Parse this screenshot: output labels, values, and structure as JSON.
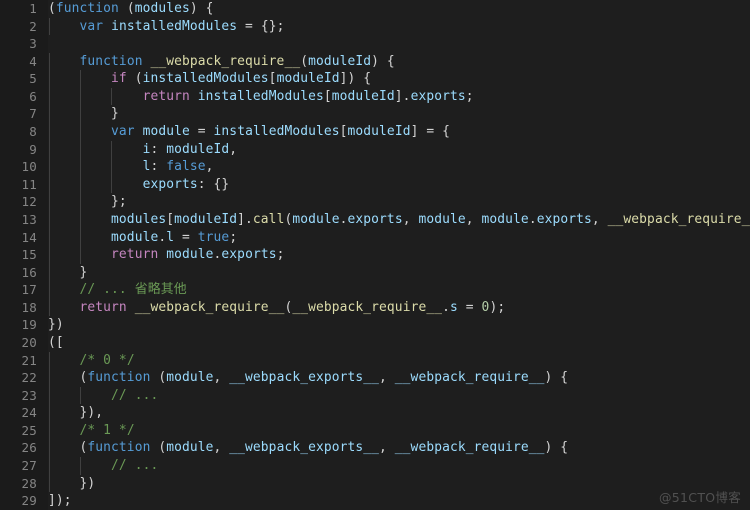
{
  "editor": {
    "theme": "vscode-dark",
    "background_color": "#1e1e1e",
    "gutter_background_color": "#1b1b1b",
    "line_number_color": "#858585",
    "indent_guide_color": "#404040",
    "default_text_color": "#d4d4d4",
    "language": "javascript",
    "total_lines": 29,
    "colors": {
      "keyword": "#569cd6",
      "control": "#c586c0",
      "function": "#dcdcaa",
      "variable": "#9cdcfe",
      "number": "#b5cea8",
      "comment": "#6a9955",
      "punctuation": "#d4d4d4"
    },
    "line_numbers": [
      "1",
      "2",
      "3",
      "4",
      "5",
      "6",
      "7",
      "8",
      "9",
      "10",
      "11",
      "12",
      "13",
      "14",
      "15",
      "16",
      "17",
      "18",
      "19",
      "20",
      "21",
      "22",
      "23",
      "24",
      "25",
      "26",
      "27",
      "28",
      "29"
    ],
    "lines": [
      {
        "n": "1",
        "indent": 0,
        "text": "(function (modules) {",
        "tokens": [
          {
            "t": "(",
            "c": "pun"
          },
          {
            "t": "function",
            "c": "kw"
          },
          {
            "t": " (",
            "c": "pun"
          },
          {
            "t": "modules",
            "c": "var"
          },
          {
            "t": ") {",
            "c": "pun"
          }
        ]
      },
      {
        "n": "2",
        "indent": 1,
        "text": "    var installedModules = {};",
        "tokens": [
          {
            "t": "    ",
            "c": "pun"
          },
          {
            "t": "var",
            "c": "kw"
          },
          {
            "t": " ",
            "c": "pun"
          },
          {
            "t": "installedModules",
            "c": "var"
          },
          {
            "t": " = {};",
            "c": "pun"
          }
        ]
      },
      {
        "n": "3",
        "indent": 0,
        "text": "",
        "tokens": []
      },
      {
        "n": "4",
        "indent": 1,
        "text": "    function __webpack_require__(moduleId) {",
        "tokens": [
          {
            "t": "    ",
            "c": "pun"
          },
          {
            "t": "function",
            "c": "kw"
          },
          {
            "t": " ",
            "c": "pun"
          },
          {
            "t": "__webpack_require__",
            "c": "fn"
          },
          {
            "t": "(",
            "c": "pun"
          },
          {
            "t": "moduleId",
            "c": "var"
          },
          {
            "t": ") {",
            "c": "pun"
          }
        ]
      },
      {
        "n": "5",
        "indent": 2,
        "text": "        if (installedModules[moduleId]) {",
        "tokens": [
          {
            "t": "        ",
            "c": "pun"
          },
          {
            "t": "if",
            "c": "ctl"
          },
          {
            "t": " (",
            "c": "pun"
          },
          {
            "t": "installedModules",
            "c": "var"
          },
          {
            "t": "[",
            "c": "pun"
          },
          {
            "t": "moduleId",
            "c": "var"
          },
          {
            "t": "]) {",
            "c": "pun"
          }
        ]
      },
      {
        "n": "6",
        "indent": 3,
        "text": "            return installedModules[moduleId].exports;",
        "tokens": [
          {
            "t": "            ",
            "c": "pun"
          },
          {
            "t": "return",
            "c": "ctl"
          },
          {
            "t": " ",
            "c": "pun"
          },
          {
            "t": "installedModules",
            "c": "var"
          },
          {
            "t": "[",
            "c": "pun"
          },
          {
            "t": "moduleId",
            "c": "var"
          },
          {
            "t": "].",
            "c": "pun"
          },
          {
            "t": "exports",
            "c": "var"
          },
          {
            "t": ";",
            "c": "pun"
          }
        ]
      },
      {
        "n": "7",
        "indent": 2,
        "text": "        }",
        "tokens": [
          {
            "t": "        }",
            "c": "pun"
          }
        ]
      },
      {
        "n": "8",
        "indent": 2,
        "text": "        var module = installedModules[moduleId] = {",
        "tokens": [
          {
            "t": "        ",
            "c": "pun"
          },
          {
            "t": "var",
            "c": "kw"
          },
          {
            "t": " ",
            "c": "pun"
          },
          {
            "t": "module",
            "c": "var"
          },
          {
            "t": " = ",
            "c": "pun"
          },
          {
            "t": "installedModules",
            "c": "var"
          },
          {
            "t": "[",
            "c": "pun"
          },
          {
            "t": "moduleId",
            "c": "var"
          },
          {
            "t": "] = {",
            "c": "pun"
          }
        ]
      },
      {
        "n": "9",
        "indent": 3,
        "text": "            i: moduleId,",
        "tokens": [
          {
            "t": "            ",
            "c": "pun"
          },
          {
            "t": "i",
            "c": "prop"
          },
          {
            "t": ": ",
            "c": "pun"
          },
          {
            "t": "moduleId",
            "c": "var"
          },
          {
            "t": ",",
            "c": "pun"
          }
        ]
      },
      {
        "n": "10",
        "indent": 3,
        "text": "            l: false,",
        "tokens": [
          {
            "t": "            ",
            "c": "pun"
          },
          {
            "t": "l",
            "c": "prop"
          },
          {
            "t": ": ",
            "c": "pun"
          },
          {
            "t": "false",
            "c": "kw"
          },
          {
            "t": ",",
            "c": "pun"
          }
        ]
      },
      {
        "n": "11",
        "indent": 3,
        "text": "            exports: {}",
        "tokens": [
          {
            "t": "            ",
            "c": "pun"
          },
          {
            "t": "exports",
            "c": "prop"
          },
          {
            "t": ": {}",
            "c": "pun"
          }
        ]
      },
      {
        "n": "12",
        "indent": 2,
        "text": "        };",
        "tokens": [
          {
            "t": "        };",
            "c": "pun"
          }
        ]
      },
      {
        "n": "13",
        "indent": 2,
        "text": "        modules[moduleId].call(module.exports, module, module.exports, __webpack_require__);",
        "tokens": [
          {
            "t": "        ",
            "c": "pun"
          },
          {
            "t": "modules",
            "c": "var"
          },
          {
            "t": "[",
            "c": "pun"
          },
          {
            "t": "moduleId",
            "c": "var"
          },
          {
            "t": "].",
            "c": "pun"
          },
          {
            "t": "call",
            "c": "fn"
          },
          {
            "t": "(",
            "c": "pun"
          },
          {
            "t": "module",
            "c": "var"
          },
          {
            "t": ".",
            "c": "pun"
          },
          {
            "t": "exports",
            "c": "var"
          },
          {
            "t": ", ",
            "c": "pun"
          },
          {
            "t": "module",
            "c": "var"
          },
          {
            "t": ", ",
            "c": "pun"
          },
          {
            "t": "module",
            "c": "var"
          },
          {
            "t": ".",
            "c": "pun"
          },
          {
            "t": "exports",
            "c": "var"
          },
          {
            "t": ", ",
            "c": "pun"
          },
          {
            "t": "__webpack_require__",
            "c": "fn"
          },
          {
            "t": ");",
            "c": "pun"
          }
        ]
      },
      {
        "n": "14",
        "indent": 2,
        "text": "        module.l = true;",
        "tokens": [
          {
            "t": "        ",
            "c": "pun"
          },
          {
            "t": "module",
            "c": "var"
          },
          {
            "t": ".",
            "c": "pun"
          },
          {
            "t": "l",
            "c": "var"
          },
          {
            "t": " = ",
            "c": "pun"
          },
          {
            "t": "true",
            "c": "kw"
          },
          {
            "t": ";",
            "c": "pun"
          }
        ]
      },
      {
        "n": "15",
        "indent": 2,
        "text": "        return module.exports;",
        "tokens": [
          {
            "t": "        ",
            "c": "pun"
          },
          {
            "t": "return",
            "c": "ctl"
          },
          {
            "t": " ",
            "c": "pun"
          },
          {
            "t": "module",
            "c": "var"
          },
          {
            "t": ".",
            "c": "pun"
          },
          {
            "t": "exports",
            "c": "var"
          },
          {
            "t": ";",
            "c": "pun"
          }
        ]
      },
      {
        "n": "16",
        "indent": 1,
        "text": "    }",
        "tokens": [
          {
            "t": "    }",
            "c": "pun"
          }
        ]
      },
      {
        "n": "17",
        "indent": 1,
        "text": "    // ... 省略其他",
        "tokens": [
          {
            "t": "    ",
            "c": "pun"
          },
          {
            "t": "// ... 省略其他",
            "c": "com"
          }
        ]
      },
      {
        "n": "18",
        "indent": 1,
        "text": "    return __webpack_require__(__webpack_require__.s = 0);",
        "tokens": [
          {
            "t": "    ",
            "c": "pun"
          },
          {
            "t": "return",
            "c": "ctl"
          },
          {
            "t": " ",
            "c": "pun"
          },
          {
            "t": "__webpack_require__",
            "c": "fn"
          },
          {
            "t": "(",
            "c": "pun"
          },
          {
            "t": "__webpack_require__",
            "c": "fn"
          },
          {
            "t": ".",
            "c": "pun"
          },
          {
            "t": "s",
            "c": "var"
          },
          {
            "t": " = ",
            "c": "pun"
          },
          {
            "t": "0",
            "c": "num"
          },
          {
            "t": ");",
            "c": "pun"
          }
        ]
      },
      {
        "n": "19",
        "indent": 0,
        "text": "})",
        "tokens": [
          {
            "t": "})",
            "c": "pun"
          }
        ]
      },
      {
        "n": "20",
        "indent": 0,
        "text": "([",
        "tokens": [
          {
            "t": "([",
            "c": "pun"
          }
        ]
      },
      {
        "n": "21",
        "indent": 1,
        "text": "    /* 0 */",
        "tokens": [
          {
            "t": "    ",
            "c": "pun"
          },
          {
            "t": "/* 0 */",
            "c": "com"
          }
        ]
      },
      {
        "n": "22",
        "indent": 1,
        "text": "    (function (module, __webpack_exports__, __webpack_require__) {",
        "tokens": [
          {
            "t": "    (",
            "c": "pun"
          },
          {
            "t": "function",
            "c": "kw"
          },
          {
            "t": " (",
            "c": "pun"
          },
          {
            "t": "module",
            "c": "var"
          },
          {
            "t": ", ",
            "c": "pun"
          },
          {
            "t": "__webpack_exports__",
            "c": "var"
          },
          {
            "t": ", ",
            "c": "pun"
          },
          {
            "t": "__webpack_require__",
            "c": "var"
          },
          {
            "t": ") {",
            "c": "pun"
          }
        ]
      },
      {
        "n": "23",
        "indent": 2,
        "text": "        // ...",
        "tokens": [
          {
            "t": "        ",
            "c": "pun"
          },
          {
            "t": "// ...",
            "c": "com"
          }
        ]
      },
      {
        "n": "24",
        "indent": 1,
        "text": "    }),",
        "tokens": [
          {
            "t": "    }),",
            "c": "pun"
          }
        ]
      },
      {
        "n": "25",
        "indent": 1,
        "text": "    /* 1 */",
        "tokens": [
          {
            "t": "    ",
            "c": "pun"
          },
          {
            "t": "/* 1 */",
            "c": "com"
          }
        ]
      },
      {
        "n": "26",
        "indent": 1,
        "text": "    (function (module, __webpack_exports__, __webpack_require__) {",
        "tokens": [
          {
            "t": "    (",
            "c": "pun"
          },
          {
            "t": "function",
            "c": "kw"
          },
          {
            "t": " (",
            "c": "pun"
          },
          {
            "t": "module",
            "c": "var"
          },
          {
            "t": ", ",
            "c": "pun"
          },
          {
            "t": "__webpack_exports__",
            "c": "var"
          },
          {
            "t": ", ",
            "c": "pun"
          },
          {
            "t": "__webpack_require__",
            "c": "var"
          },
          {
            "t": ") {",
            "c": "pun"
          }
        ]
      },
      {
        "n": "27",
        "indent": 2,
        "text": "        // ...",
        "tokens": [
          {
            "t": "        ",
            "c": "pun"
          },
          {
            "t": "// ...",
            "c": "com"
          }
        ]
      },
      {
        "n": "28",
        "indent": 1,
        "text": "    })",
        "tokens": [
          {
            "t": "    })",
            "c": "pun"
          }
        ]
      },
      {
        "n": "29",
        "indent": 0,
        "text": "]);",
        "tokens": [
          {
            "t": "]);",
            "c": "pun"
          }
        ]
      }
    ]
  },
  "watermark": {
    "text": "@51CTO博客",
    "color": "#5a5a5a"
  }
}
